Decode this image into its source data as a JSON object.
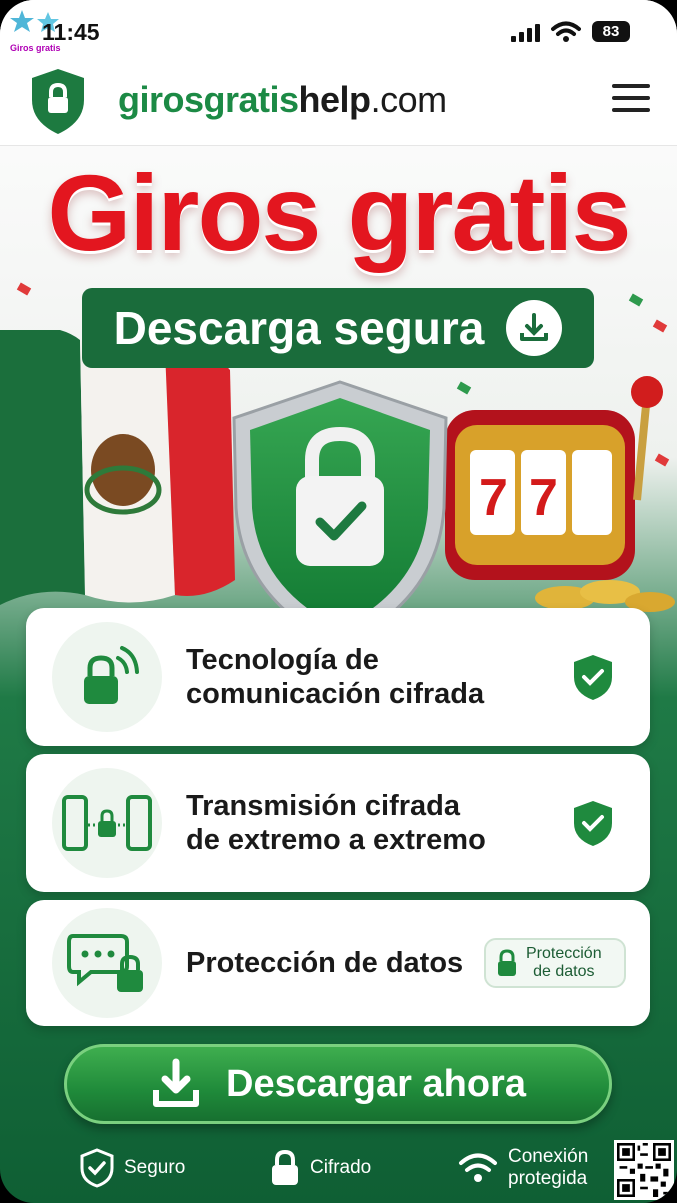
{
  "status_bar": {
    "time": "11:45",
    "battery": "83",
    "corner_label": "Giros gratis"
  },
  "header": {
    "brand_part1": "girosgratis",
    "brand_part2": "help",
    "brand_part3": ".com"
  },
  "hero": {
    "title": "Giros gratis",
    "pill_label": "Descarga segura"
  },
  "features": [
    {
      "line1": "Tecnología de",
      "line2": "comunicación cifrada"
    },
    {
      "line1": "Transmisión cifrada",
      "line2": "de extremo a extremo"
    },
    {
      "line1": "Protección de datos",
      "badge_line1": "Protección",
      "badge_line2": "de datos"
    }
  ],
  "cta": {
    "label": "Descargar ahora"
  },
  "footer": [
    {
      "label": "Seguro"
    },
    {
      "label": "Cifrado"
    },
    {
      "label_line1": "Conexión",
      "label_line2": "protegida"
    }
  ],
  "colors": {
    "brand_green": "#1c8a45",
    "title_red": "#e3161f",
    "dark_green": "#1a6c3b"
  }
}
